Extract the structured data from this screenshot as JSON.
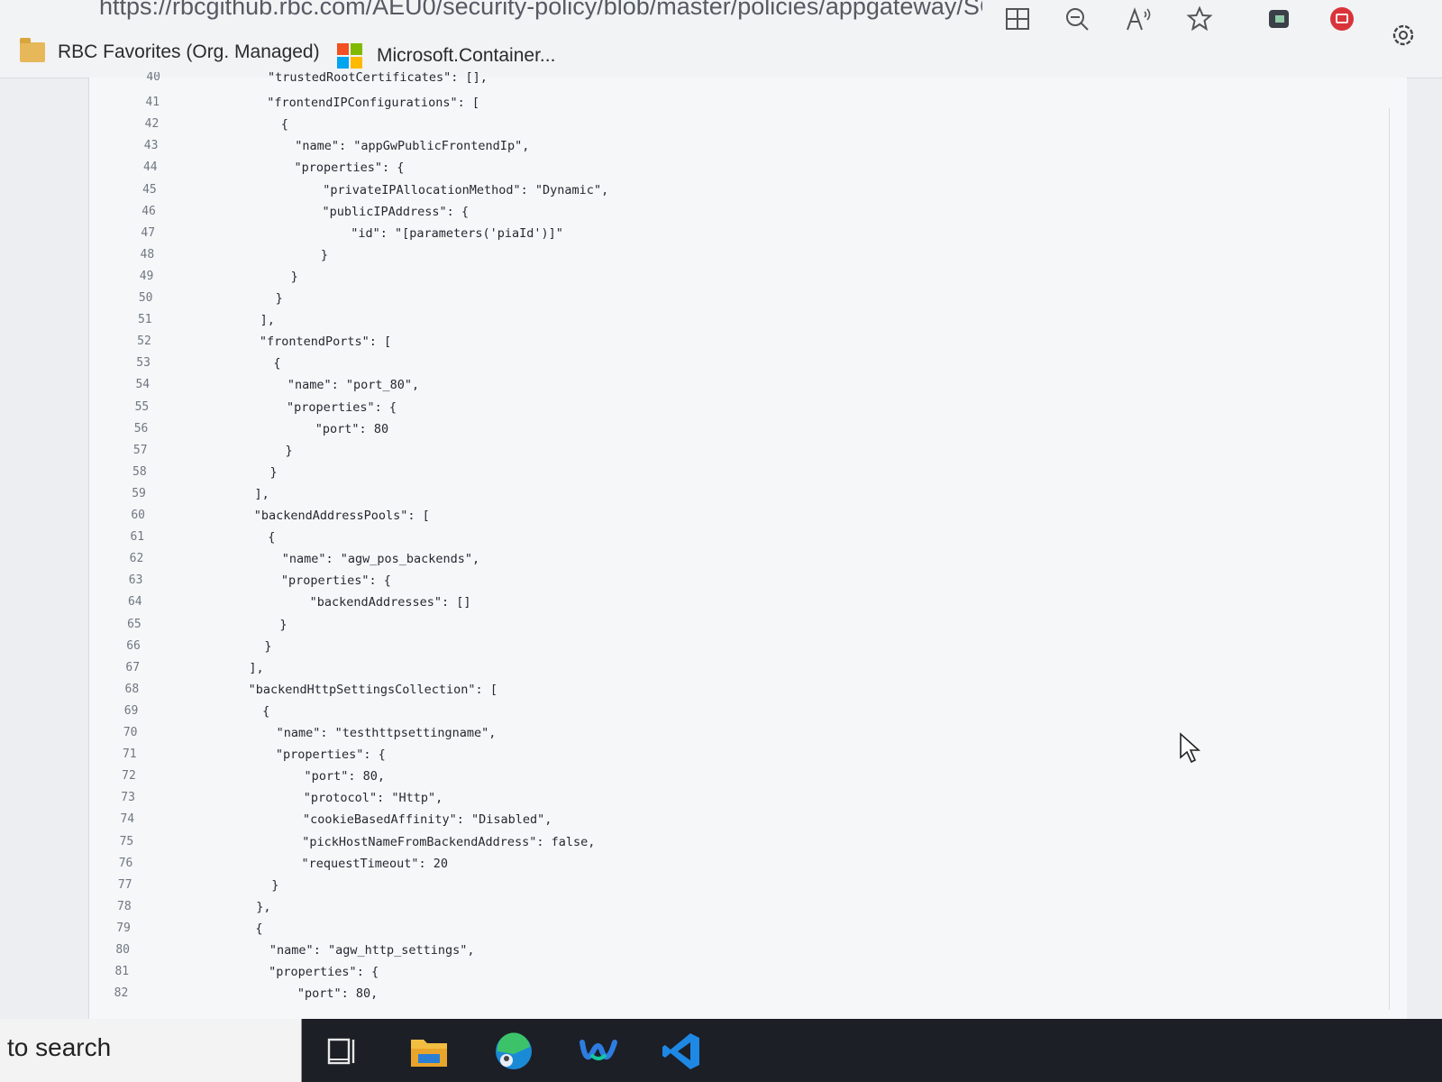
{
  "browser": {
    "url": "https://rbcgithub.rbc.com/AEU0/security-policy/blob/master/policies/appgateway/SC...",
    "bookmarks": [
      {
        "label": "RBC Favorites (Org. Managed)",
        "icon": "folder-icon"
      },
      {
        "label": "Microsoft.Container...",
        "icon": "microsoft-icon"
      }
    ],
    "toolbar_icons": [
      "split-screen-icon",
      "zoom-out-icon",
      "read-aloud-icon",
      "favorite-star-icon",
      "extension-icon",
      "profile-icon",
      "settings-icon"
    ]
  },
  "code": {
    "lines": [
      {
        "num": "40",
        "text": "        \"trustedRootCertificates\": [],",
        "partial": true
      },
      {
        "num": "41",
        "text": "        \"frontendIPConfigurations\": ["
      },
      {
        "num": "42",
        "text": "          {"
      },
      {
        "num": "43",
        "text": "            \"name\": \"appGwPublicFrontendIp\","
      },
      {
        "num": "44",
        "text": "            \"properties\": {"
      },
      {
        "num": "45",
        "text": "                \"privateIPAllocationMethod\": \"Dynamic\","
      },
      {
        "num": "46",
        "text": "                \"publicIPAddress\": {"
      },
      {
        "num": "47",
        "text": "                    \"id\": \"[parameters('piaId')]\""
      },
      {
        "num": "48",
        "text": "                }"
      },
      {
        "num": "49",
        "text": "            }"
      },
      {
        "num": "50",
        "text": "          }"
      },
      {
        "num": "51",
        "text": "        ],"
      },
      {
        "num": "52",
        "text": "        \"frontendPorts\": ["
      },
      {
        "num": "53",
        "text": "          {"
      },
      {
        "num": "54",
        "text": "            \"name\": \"port_80\","
      },
      {
        "num": "55",
        "text": "            \"properties\": {"
      },
      {
        "num": "56",
        "text": "                \"port\": 80"
      },
      {
        "num": "57",
        "text": "            }"
      },
      {
        "num": "58",
        "text": "          }"
      },
      {
        "num": "59",
        "text": "        ],"
      },
      {
        "num": "60",
        "text": "        \"backendAddressPools\": ["
      },
      {
        "num": "61",
        "text": "          {"
      },
      {
        "num": "62",
        "text": "            \"name\": \"agw_pos_backends\","
      },
      {
        "num": "63",
        "text": "            \"properties\": {"
      },
      {
        "num": "64",
        "text": "                \"backendAddresses\": []"
      },
      {
        "num": "65",
        "text": "            }"
      },
      {
        "num": "66",
        "text": "          }"
      },
      {
        "num": "67",
        "text": "        ],"
      },
      {
        "num": "68",
        "text": "        \"backendHttpSettingsCollection\": ["
      },
      {
        "num": "69",
        "text": "          {"
      },
      {
        "num": "70",
        "text": "            \"name\": \"testhttpsettingname\","
      },
      {
        "num": "71",
        "text": "            \"properties\": {"
      },
      {
        "num": "72",
        "text": "                \"port\": 80,"
      },
      {
        "num": "73",
        "text": "                \"protocol\": \"Http\","
      },
      {
        "num": "74",
        "text": "                \"cookieBasedAffinity\": \"Disabled\","
      },
      {
        "num": "75",
        "text": "                \"pickHostNameFromBackendAddress\": false,"
      },
      {
        "num": "76",
        "text": "                \"requestTimeout\": 20"
      },
      {
        "num": "77",
        "text": "            }"
      },
      {
        "num": "78",
        "text": "          },"
      },
      {
        "num": "79",
        "text": "          {"
      },
      {
        "num": "80",
        "text": "            \"name\": \"agw_http_settings\","
      },
      {
        "num": "81",
        "text": "            \"properties\": {"
      },
      {
        "num": "82",
        "text": "                \"port\": 80,"
      }
    ]
  },
  "taskbar": {
    "search_text": "to search",
    "apps": [
      "task-view-icon",
      "file-explorer-icon",
      "edge-icon",
      "webex-icon",
      "vscode-icon"
    ]
  }
}
